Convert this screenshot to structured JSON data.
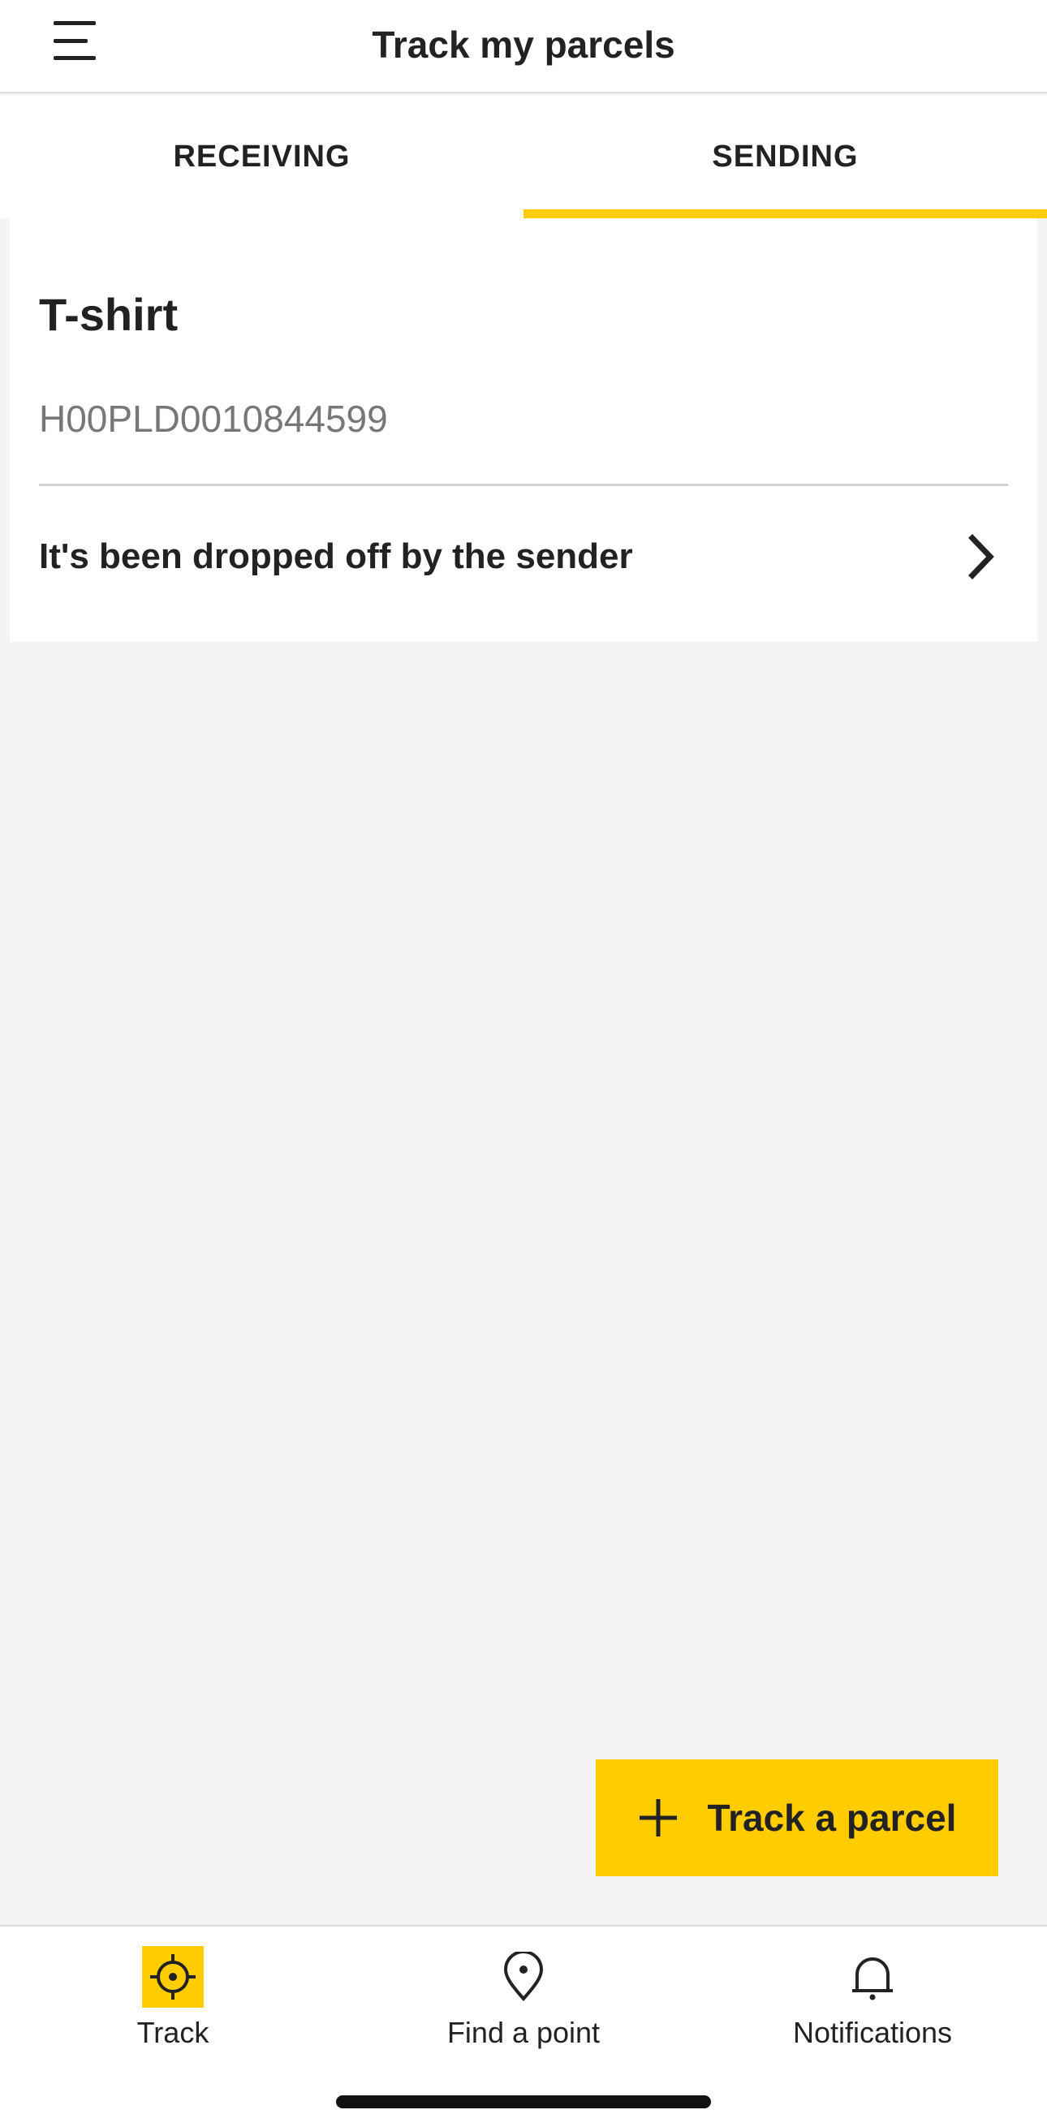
{
  "header": {
    "title": "Track my parcels"
  },
  "tabs": [
    {
      "label": "RECEIVING",
      "active": false
    },
    {
      "label": "SENDING",
      "active": true
    }
  ],
  "parcel": {
    "name": "T-shirt",
    "tracking_number": "H00PLD0010844599",
    "status": "It's been dropped off by the sender"
  },
  "fab": {
    "label": "Track a parcel",
    "icon": "plus-icon"
  },
  "bottom_nav": [
    {
      "label": "Track",
      "icon": "crosshair-icon",
      "active": true
    },
    {
      "label": "Find a point",
      "icon": "map-pin-icon",
      "active": false
    },
    {
      "label": "Notifications",
      "icon": "bell-icon",
      "active": false
    }
  ],
  "colors": {
    "accent": "#ffcc00",
    "background": "#f4f4f4",
    "text": "#222222",
    "muted": "#777777"
  }
}
